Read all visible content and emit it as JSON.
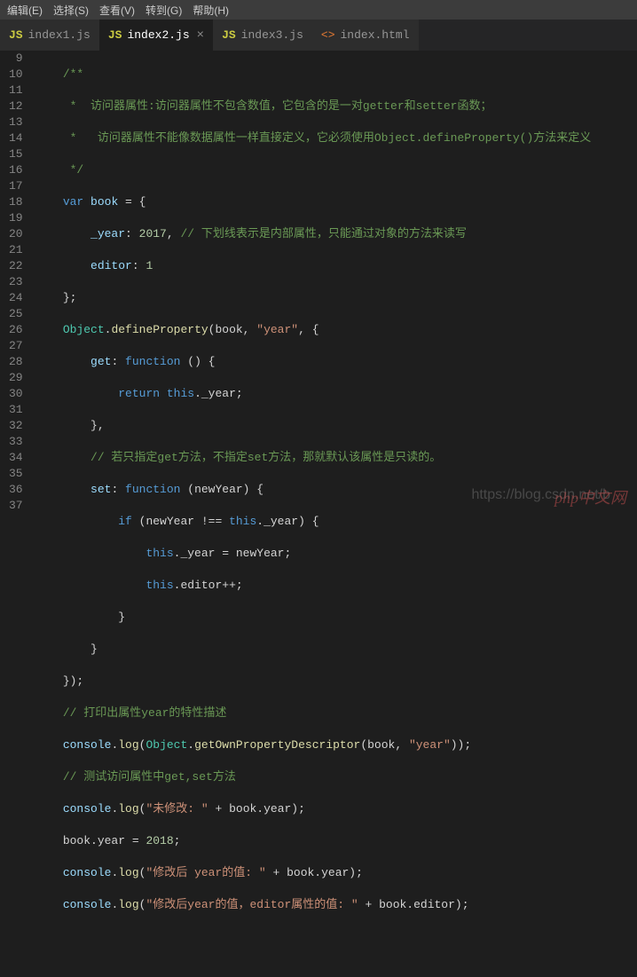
{
  "menu": {
    "items": [
      "编辑(E)",
      "选择(S)",
      "查看(V)",
      "转到(G)",
      "帮助(H)"
    ]
  },
  "tabs": [
    {
      "label": "index1.js",
      "kind": "js"
    },
    {
      "label": "index2.js",
      "kind": "js",
      "active": true,
      "close": "×"
    },
    {
      "label": "index3.js",
      "kind": "js"
    },
    {
      "label": "index.html",
      "kind": "html"
    }
  ],
  "gutter": {
    "start": 9,
    "end": 37
  },
  "code": {
    "l9": "/**",
    "l10": " *  访问器属性:访问器属性不包含数值，它包含的是一对getter和setter函数；",
    "l11": " *   访问器属性不能像数据属性一样直接定义，它必须使用Object.defineProperty()方法来定义",
    "l12": " */",
    "l13_var": "var",
    "l13_name": " book ",
    "l13_eq": "= {",
    "l14_key": "_year",
    "l14_val": "2017",
    "l14_cm": "// 下划线表示是内部属性，只能通过对象的方法来读写",
    "l15_key": "editor",
    "l15_val": "1",
    "l16": "};",
    "l17_obj": "Object",
    "l17_fn": "defineProperty",
    "l17_args_a": "(book, ",
    "l17_str": "\"year\"",
    "l17_args_b": ", {",
    "l18_key": "get",
    "l18_fn": "function",
    "l18_p": " () {",
    "l19_ret": "return",
    "l19_this": "this",
    "l19_prop": "._year;",
    "l20": "},",
    "l21_cm": "// 若只指定get方法，不指定set方法，那就默认该属性是只读的。",
    "l22_key": "set",
    "l22_fn": "function",
    "l22_p": " (newYear) {",
    "l23_if": "if",
    "l23_a": " (newYear !== ",
    "l23_this": "this",
    "l23_b": "._year) {",
    "l24_this": "this",
    "l24_a": "._year = newYear;",
    "l25_this": "this",
    "l25_a": ".editor++;",
    "l26": "}",
    "l27": "}",
    "l28": "});",
    "l29_cm": "// 打印出属性year的特性描述",
    "l30_c": "console",
    "l30_log": "log",
    "l30_obj": "Object",
    "l30_fn": "getOwnPropertyDescriptor",
    "l30_str": "\"year\"",
    "l31_cm": "// 测试访问属性中get,set方法",
    "l32_c": "console",
    "l32_log": "log",
    "l32_str": "\"未修改: \"",
    "l32_tail": " + book.year);",
    "l33": "book.year = ",
    "l33_n": "2018",
    "l33_e": ";",
    "l34_c": "console",
    "l34_log": "log",
    "l34_str": "\"修改后 year的值: \"",
    "l34_tail": " + book.year);",
    "l35_c": "console",
    "l35_log": "log",
    "l35_str": "\"修改后year的值，editor属性的值: \"",
    "l35_tail": " + book.editor);"
  },
  "watermark": {
    "a": "https://blog.csdn.net/b",
    "b": "php中文网"
  }
}
